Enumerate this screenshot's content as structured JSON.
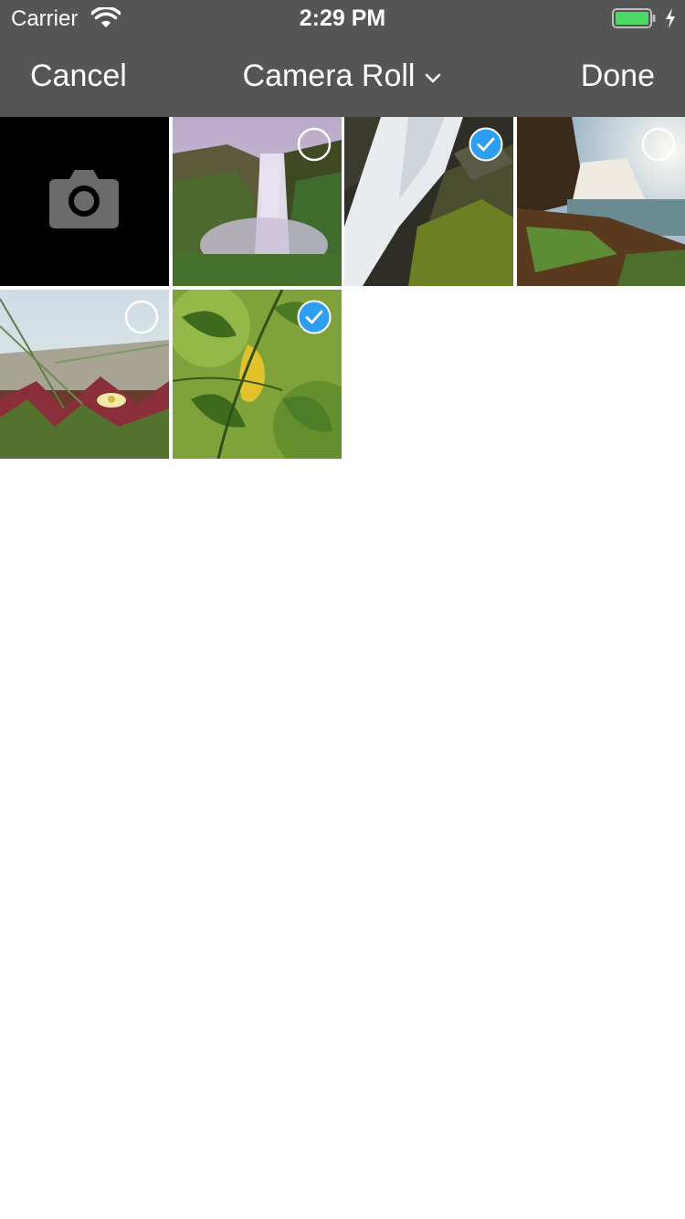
{
  "status_bar": {
    "carrier": "Carrier",
    "time": "2:29 PM",
    "battery_color": "#4cd964"
  },
  "nav": {
    "cancel_label": "Cancel",
    "album_title": "Camera Roll",
    "done_label": "Done"
  },
  "grid": {
    "camera_tile": {
      "icon": "camera-icon"
    },
    "photos": [
      {
        "subject": "waterfall-misty",
        "selected": false
      },
      {
        "subject": "waterfall-closeup",
        "selected": true
      },
      {
        "subject": "waterfall-sunset",
        "selected": false
      },
      {
        "subject": "dune-flower",
        "selected": false
      },
      {
        "subject": "green-leaves",
        "selected": true
      }
    ]
  },
  "colors": {
    "bar_bg": "#555555",
    "selected_blue": "#2d9ef0",
    "background": "#ffffff"
  }
}
